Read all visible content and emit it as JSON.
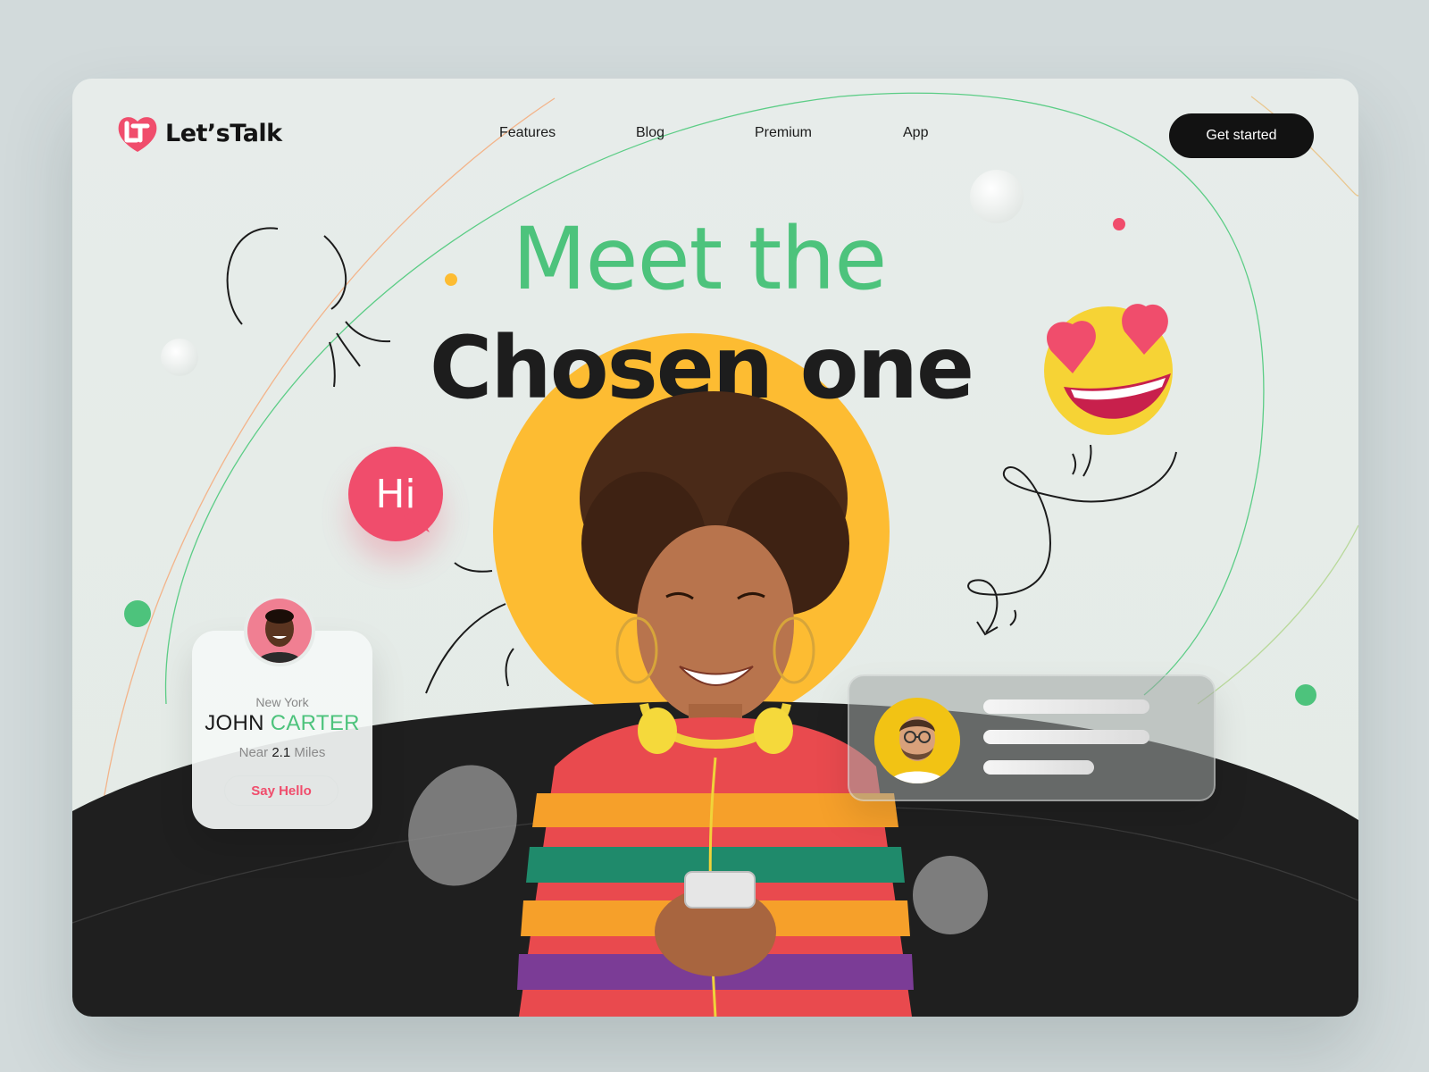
{
  "brand": {
    "name": "Let’sTalk",
    "logo_initials": "LT",
    "accent": "#f04d6c"
  },
  "nav": {
    "items": [
      {
        "label": "Features"
      },
      {
        "label": "Blog"
      },
      {
        "label": "Premium"
      },
      {
        "label": "App"
      }
    ],
    "cta_label": "Get started"
  },
  "hero": {
    "line1": "Meet the",
    "line2": "Chosen one",
    "greeting_bubble": "Hi",
    "colors": {
      "green": "#4dc37c",
      "dark": "#1d1d1d",
      "yellow": "#fdbc32",
      "pink": "#f04d6c"
    }
  },
  "profile_card": {
    "city": "New York",
    "first_name": "JOHN",
    "last_name": "CARTER",
    "distance_prefix": "Near",
    "distance_value": "2.1",
    "distance_unit": "Miles",
    "button_label": "Say Hello"
  },
  "message_card": {
    "avatar_icon": "user-avatar-glasses"
  },
  "emoji": {
    "icon": "heart-eyes-emoji"
  }
}
